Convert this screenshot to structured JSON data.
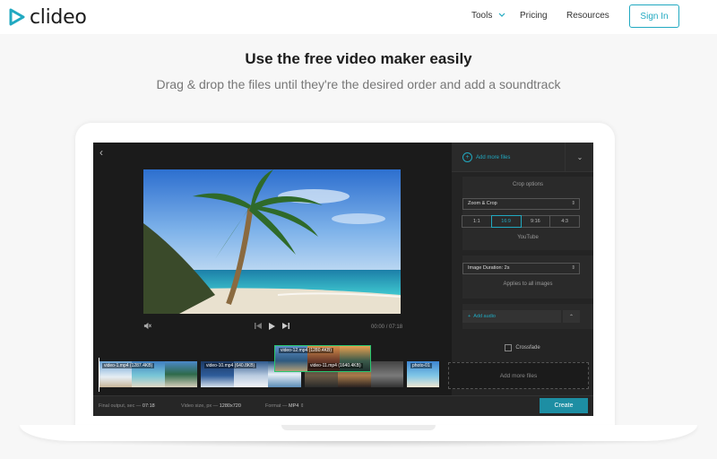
{
  "header": {
    "logo_text": "clideo",
    "nav": {
      "tools": "Tools",
      "pricing": "Pricing",
      "resources": "Resources"
    },
    "signin": "Sign In"
  },
  "hero": {
    "title": "Use the free video maker easily",
    "subtitle": "Drag & drop the files until they're the desired order and add a soundtrack"
  },
  "editor": {
    "player": {
      "time_current": "00:00",
      "time_separator": "/",
      "time_total": "07:18"
    },
    "sidebar": {
      "add_more_files": "Add more files",
      "crop_options_label": "Crop options",
      "crop_mode": "Zoom & Crop",
      "ratios": [
        "1:1",
        "16:9",
        "9:16",
        "4:3"
      ],
      "active_ratio": "16:9",
      "ratio_hint": "YouTube",
      "image_duration": "Image Duration: 2s",
      "applies_hint": "Applies to all images",
      "add_audio": "Add audio",
      "crossfade": "Crossfade"
    },
    "timeline": {
      "clips": [
        {
          "label": "video-1.mp4 (1287.4KB)"
        },
        {
          "label": "video-10.mp4 (640.8KB)"
        },
        {
          "label": "video-11.mp4 (1640.4KB)"
        },
        {
          "label": "photo-01"
        }
      ],
      "dragged_label": "video-12.mp4 (1280.4KB)",
      "add_more_files": "Add more files"
    },
    "bottom": {
      "final_output_label": "Final output, sec",
      "final_output_value": "07:18",
      "video_size_label": "Video size, px",
      "video_size_value": "1280x720",
      "format_label": "Format",
      "format_value": "MP4",
      "create": "Create"
    }
  },
  "colors": {
    "accent": "#21a9c1",
    "editor_bg": "#1b1b1b",
    "create_btn": "#1d8ea3",
    "drag_border": "#28c76f"
  }
}
